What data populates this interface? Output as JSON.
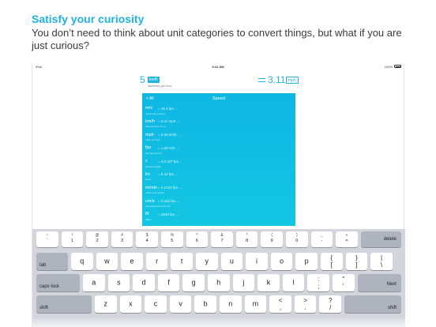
{
  "promo": {
    "title": "Satisfy your curiosity",
    "subtitle": "You don’t need to think about unit categories to convert things, but what if you are just curious?"
  },
  "statusbar": {
    "device": "iPad",
    "time": "9:41 AM",
    "battery": "100%"
  },
  "converter": {
    "input_value": "5",
    "input_unit": "km/h",
    "input_desc": "kilometers per hour",
    "result_value": "3.11",
    "result_unit": "mph"
  },
  "panel": {
    "back_label": "< All",
    "title": "Speed",
    "rows": [
      {
        "sym": "m/s",
        "val": "= 16.4 fps ...",
        "desc": "meters per second"
      },
      {
        "sym": "km/h",
        "val": "= 3.11 mph ...",
        "desc": "kilometers per hour"
      },
      {
        "sym": "mph",
        "val": "= 8.05 km/h ...",
        "desc": "miles per hour"
      },
      {
        "sym": "fps",
        "val": "= 1.52 m/s ...",
        "desc": "feet per second"
      },
      {
        "sym": "c",
        "val": "= 4.9·10⁸ fps ...",
        "desc": "speeds of light"
      },
      {
        "sym": "kn",
        "val": "= 8.44 fps ...",
        "desc": "knots"
      },
      {
        "sym": "m/min",
        "val": "= 0.2734 fps ...",
        "desc": "meters per minute"
      },
      {
        "sym": "cm/s",
        "val": "= 0.164 fps ...",
        "desc": "centimeters per second"
      },
      {
        "sym": "M",
        "val": "= 4840 fps ...",
        "desc": "Mach"
      }
    ]
  },
  "keyboard": {
    "row1": [
      {
        "top": "~",
        "bot": "`"
      },
      {
        "top": "!",
        "bot": "1"
      },
      {
        "top": "@",
        "bot": "2"
      },
      {
        "top": "#",
        "bot": "3"
      },
      {
        "top": "$",
        "bot": "4"
      },
      {
        "top": "%",
        "bot": "5"
      },
      {
        "top": "^",
        "bot": "6"
      },
      {
        "top": "&",
        "bot": "7"
      },
      {
        "top": "*",
        "bot": "8"
      },
      {
        "top": "(",
        "bot": "9"
      },
      {
        "top": ")",
        "bot": "0"
      },
      {
        "top": "_",
        "bot": "-"
      },
      {
        "top": "+",
        "bot": "="
      }
    ],
    "delete": "delete",
    "tab": "tab",
    "row2": [
      "q",
      "w",
      "e",
      "r",
      "t",
      "y",
      "u",
      "i",
      "o",
      "p"
    ],
    "row2_pairs": [
      {
        "top": "{",
        "bot": "["
      },
      {
        "top": "}",
        "bot": "]"
      },
      {
        "top": "|",
        "bot": "\\"
      }
    ],
    "caps": "caps lock",
    "row3": [
      "a",
      "s",
      "d",
      "f",
      "g",
      "h",
      "j",
      "k",
      "l"
    ],
    "row3_pairs": [
      {
        "top": ":",
        "bot": ";"
      },
      {
        "top": "\"",
        "bot": "'"
      }
    ],
    "next": "Next",
    "shift": "shift",
    "row4": [
      "z",
      "x",
      "c",
      "v",
      "b",
      "n",
      "m"
    ],
    "row4_pairs": [
      {
        "top": "<",
        "bot": ","
      },
      {
        "top": ">",
        "bot": "."
      },
      {
        "top": "?",
        "bot": "/"
      }
    ]
  }
}
